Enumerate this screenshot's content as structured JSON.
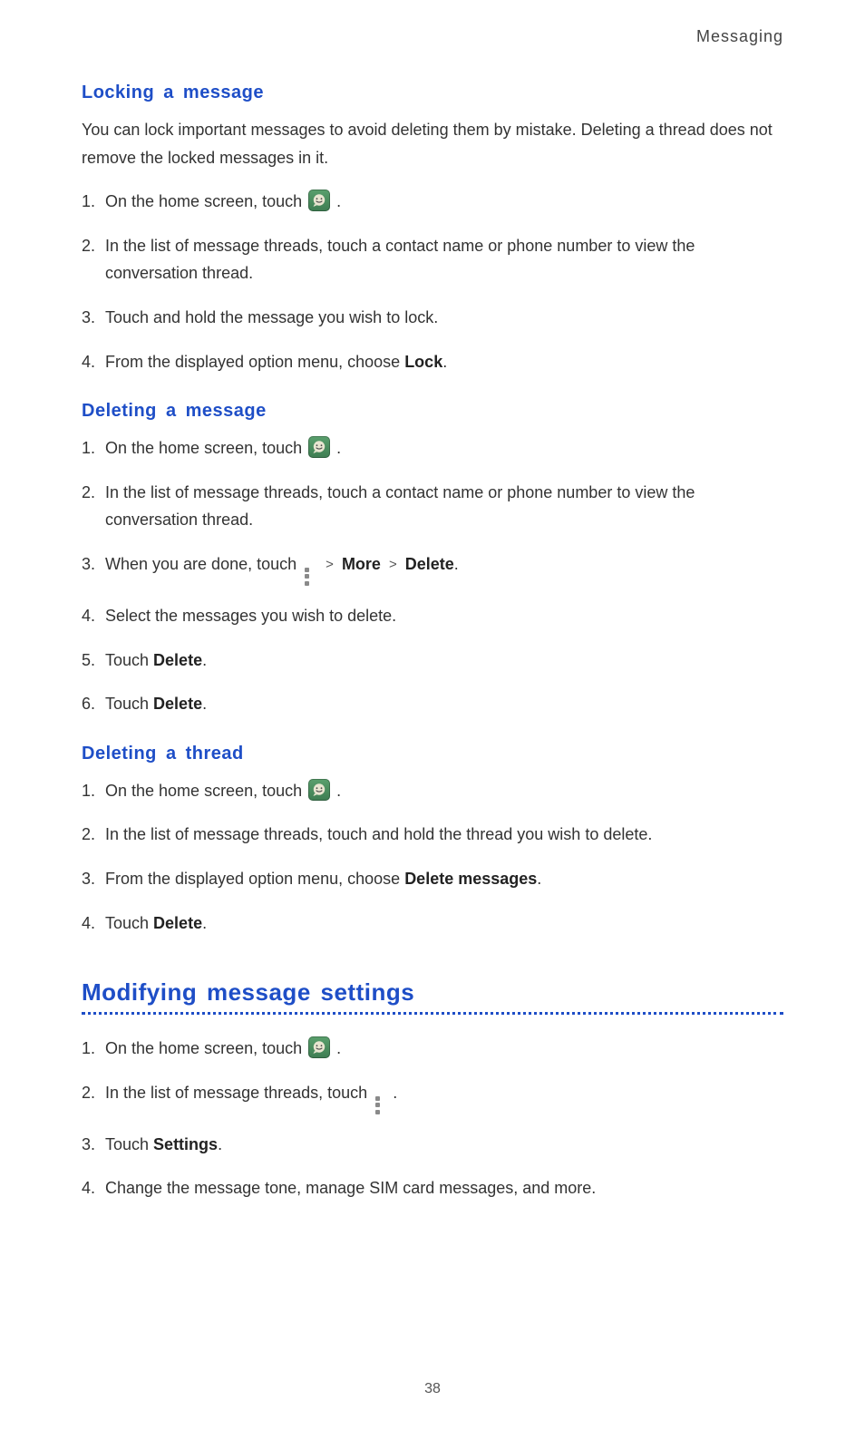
{
  "header": {
    "label": "Messaging"
  },
  "sections": {
    "lock": {
      "heading": "Locking  a  message",
      "intro": "You can lock important messages to avoid deleting them by mistake. Deleting a thread does not remove the locked messages in it.",
      "step1_pre": "On the home screen, touch ",
      "step1_post": " .",
      "step2": "In the list of message threads, touch a contact name or phone number to view the conversation thread.",
      "step3": "Touch and hold the message you wish to lock.",
      "step4_pre": "From the displayed option menu, choose ",
      "step4_bold": "Lock",
      "step4_post": "."
    },
    "delmsg": {
      "heading": "Deleting  a  message",
      "step1_pre": "On the home screen, touch ",
      "step1_post": " .",
      "step2": "In the list of message threads, touch a contact name or phone number to view the conversation thread.",
      "step3_pre": "When you are done, touch ",
      "step3_more": "More",
      "step3_delete": "Delete",
      "step3_post": ".",
      "step4": "Select the messages you wish to delete.",
      "step5_pre": "Touch ",
      "step5_bold": "Delete",
      "step5_post": ".",
      "step6_pre": "Touch ",
      "step6_bold": "Delete",
      "step6_post": "."
    },
    "delthread": {
      "heading": "Deleting  a  thread",
      "step1_pre": "On the home screen, touch ",
      "step1_post": " .",
      "step2": "In the list of message threads, touch and hold the thread you wish to delete.",
      "step3_pre": "From the displayed option menu, choose ",
      "step3_bold": "Delete messages",
      "step3_post": ".",
      "step4_pre": "Touch ",
      "step4_bold": "Delete",
      "step4_post": "."
    },
    "settings": {
      "heading": "Modifying message settings",
      "step1_pre": "On the home screen, touch ",
      "step1_post": " .",
      "step2_pre": "In the list of message threads, touch ",
      "step2_post": " .",
      "step3_pre": "Touch ",
      "step3_bold": "Settings",
      "step3_post": ".",
      "step4": "Change the message tone, manage SIM card messages, and more."
    }
  },
  "symbols": {
    "gt": ">"
  },
  "page_number": "38"
}
